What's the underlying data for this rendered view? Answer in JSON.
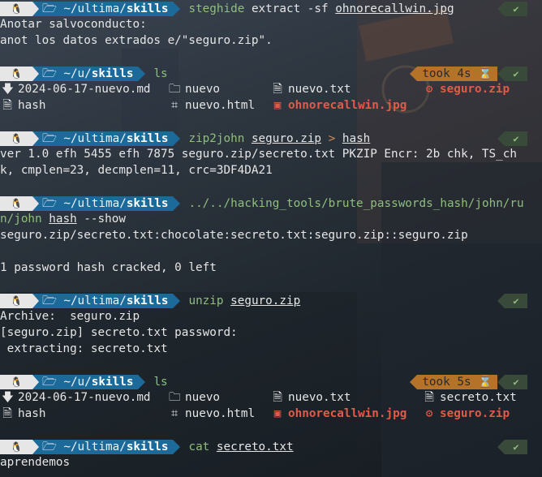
{
  "colors": {
    "dir_bg": "#1c6a9a",
    "cmd": "#8fbf7f",
    "took_bg": "#b5732a",
    "zip": "#e05b4a"
  },
  "prompt": {
    "os_icon": "linux-penguin-icon",
    "folder_icon": "folder-open-icon"
  },
  "blocks": [
    {
      "dir_prefix": "~/ultima/",
      "dir_name": "skills",
      "cmd": "steghide",
      "args": "extract -sf",
      "arg_file": "ohnorecallwin.jpg",
      "status": "✔",
      "output": [
        "Anotar salvoconducto:",
        "anot los datos extrados e/\"seguro.zip\"."
      ]
    },
    {
      "dir_prefix": "~/u/",
      "dir_name": "skills",
      "cmd": "ls",
      "status": "✔",
      "took": "took 4s",
      "listing": [
        [
          {
            "icon": "download-icon",
            "name": "2024-06-17-nuevo.md",
            "kind": "file"
          },
          {
            "icon": "folder-icon",
            "name": "nuevo",
            "kind": "file"
          },
          {
            "icon": "file-icon",
            "name": "nuevo.txt",
            "kind": "file"
          },
          {
            "icon": "zip-icon",
            "name": "seguro.zip",
            "kind": "zip"
          }
        ],
        [
          {
            "icon": "file-icon",
            "name": "hash",
            "kind": "file"
          },
          {
            "icon": "html-icon",
            "name": "nuevo.html",
            "kind": "file"
          },
          {
            "icon": "image-icon",
            "name": "ohnorecallwin.jpg",
            "kind": "img"
          }
        ]
      ]
    },
    {
      "dir_prefix": "~/ultima/",
      "dir_name": "skills",
      "cmd": "zip2john",
      "arg_file": "seguro.zip",
      "redir": ">",
      "arg_file2": "hash",
      "status": "✔",
      "output": [
        "ver 1.0 efh 5455 efh 7875 seguro.zip/secreto.txt PKZIP Encr: 2b chk, TS_ch",
        "k, cmplen=23, decmplen=11, crc=3DF4DA21"
      ]
    },
    {
      "dir_prefix": "~/ultima/",
      "dir_name": "skills",
      "cmd": "../../hacking_tools/brute_passwords_hash/john/ru",
      "cmd2": "n/john",
      "arg_file": "hash",
      "args2": "--show",
      "output": [
        "seguro.zip/secreto.txt:chocolate:secreto.txt:seguro.zip::seguro.zip",
        "",
        "1 password hash cracked, 0 left"
      ]
    },
    {
      "dir_prefix": "~/ultima/",
      "dir_name": "skills",
      "cmd": "unzip",
      "arg_file": "seguro.zip",
      "status": "✔",
      "output": [
        "Archive:  seguro.zip",
        "[seguro.zip] secreto.txt password:",
        " extracting: secreto.txt"
      ]
    },
    {
      "dir_prefix": "~/u/",
      "dir_name": "skills",
      "cmd": "ls",
      "status": "✔",
      "took": "took 5s",
      "listing": [
        [
          {
            "icon": "download-icon",
            "name": "2024-06-17-nuevo.md",
            "kind": "file"
          },
          {
            "icon": "folder-icon",
            "name": "nuevo",
            "kind": "file"
          },
          {
            "icon": "file-icon",
            "name": "nuevo.txt",
            "kind": "file"
          },
          {
            "icon": "file-icon",
            "name": "secreto.txt",
            "kind": "file"
          }
        ],
        [
          {
            "icon": "file-icon",
            "name": "hash",
            "kind": "file"
          },
          {
            "icon": "html-icon",
            "name": "nuevo.html",
            "kind": "file"
          },
          {
            "icon": "image-icon",
            "name": "ohnorecallwin.jpg",
            "kind": "img"
          },
          {
            "icon": "zip-icon",
            "name": "seguro.zip",
            "kind": "zip"
          }
        ]
      ]
    },
    {
      "dir_prefix": "~/ultima/",
      "dir_name": "skills",
      "cmd": "cat",
      "arg_file": "secreto.txt",
      "status": "✔",
      "output": [
        "aprendemos"
      ]
    }
  ]
}
